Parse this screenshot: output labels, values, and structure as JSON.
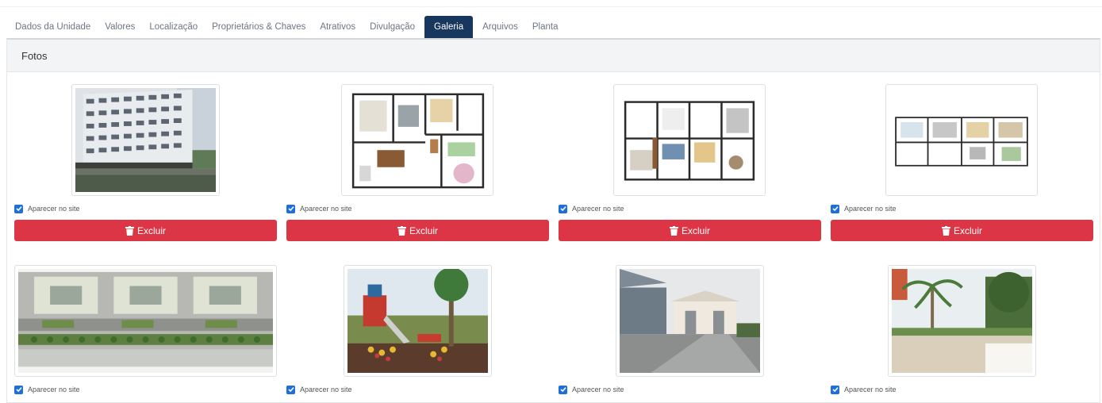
{
  "tabs": [
    {
      "label": "Dados da Unidade"
    },
    {
      "label": "Valores"
    },
    {
      "label": "Localização"
    },
    {
      "label": "Proprietários & Chaves"
    },
    {
      "label": "Atrativos"
    },
    {
      "label": "Divulgação"
    },
    {
      "label": "Galeria",
      "active": true
    },
    {
      "label": "Arquivos"
    },
    {
      "label": "Planta"
    }
  ],
  "section": {
    "title": "Fotos"
  },
  "photos": [
    {
      "kind": "building-photo",
      "show_on_site_label": "Aparecer no site",
      "checked": true,
      "delete_label": "Excluir"
    },
    {
      "kind": "floor-plan",
      "show_on_site_label": "Aparecer no site",
      "checked": true,
      "delete_label": "Excluir"
    },
    {
      "kind": "floor-plan",
      "show_on_site_label": "Aparecer no site",
      "checked": true,
      "delete_label": "Excluir"
    },
    {
      "kind": "floor-plan",
      "show_on_site_label": "Aparecer no site",
      "checked": true,
      "delete_label": "Excluir"
    },
    {
      "kind": "site-plan",
      "show_on_site_label": "Aparecer no site",
      "checked": true
    },
    {
      "kind": "playground-photo",
      "show_on_site_label": "Aparecer no site",
      "checked": true
    },
    {
      "kind": "entrance-photo",
      "show_on_site_label": "Aparecer no site",
      "checked": true
    },
    {
      "kind": "garden-photo",
      "show_on_site_label": "Aparecer no site",
      "checked": true
    }
  ],
  "colors": {
    "active_tab": "#17375e",
    "delete_button": "#dc3545",
    "checkbox": "#1e6fd9"
  }
}
